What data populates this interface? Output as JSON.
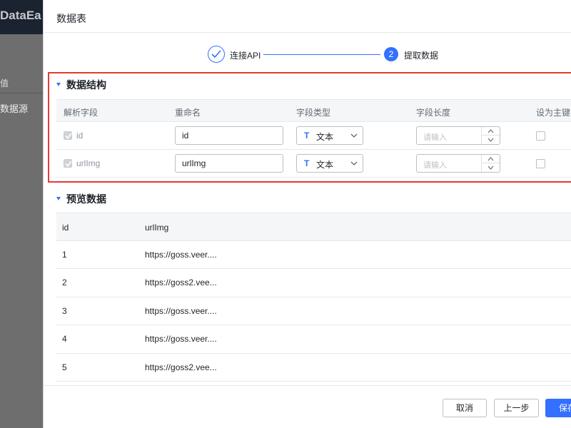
{
  "background": {
    "logo": "DataEa",
    "sidebar_item_1": "值",
    "sidebar_item_2": "数据源"
  },
  "drawer": {
    "title": "数据表"
  },
  "steps": [
    {
      "label": "连接API",
      "state": "done"
    },
    {
      "number": "2",
      "label": "提取数据",
      "state": "active"
    }
  ],
  "structure": {
    "heading": "数据结构",
    "columns": [
      "解析字段",
      "重命名",
      "字段类型",
      "字段长度",
      "设为主键"
    ],
    "rows": [
      {
        "field": "id",
        "rename": "id",
        "type": "文本",
        "length_placeholder": "请输入",
        "checked": true,
        "primary_key": false
      },
      {
        "field": "urlImg",
        "rename": "urlImg",
        "type": "文本",
        "length_placeholder": "请输入",
        "checked": true,
        "primary_key": false
      }
    ]
  },
  "preview": {
    "heading": "预览数据",
    "columns": [
      "id",
      "urlImg"
    ],
    "rows": [
      {
        "id": "1",
        "url": "https://goss.veer...."
      },
      {
        "id": "2",
        "url": "https://goss2.vee..."
      },
      {
        "id": "3",
        "url": "https://goss.veer...."
      },
      {
        "id": "4",
        "url": "https://goss.veer...."
      },
      {
        "id": "5",
        "url": "https://goss2.vee..."
      }
    ]
  },
  "footer": {
    "cancel": "取消",
    "prev": "上一步",
    "save": "保存"
  },
  "colors": {
    "accent": "#3370ff",
    "highlight": "#e53935"
  },
  "icons": {
    "step_done": "check-icon",
    "type": "text-type-icon",
    "dropdown": "chevron-down-icon",
    "section_toggle": "caret-down-icon"
  }
}
